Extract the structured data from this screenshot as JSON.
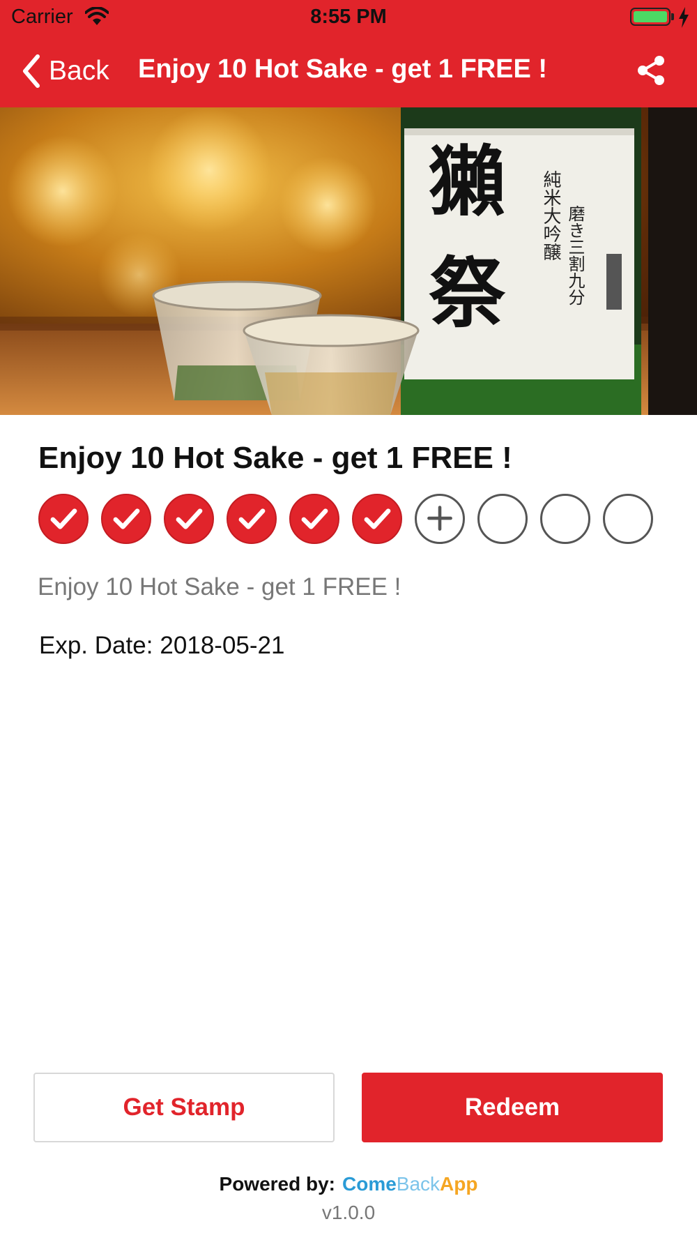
{
  "status_bar": {
    "carrier": "Carrier",
    "time": "8:55 PM",
    "battery_color": "#4cd964"
  },
  "nav": {
    "back_label": "Back",
    "title": "Enjoy 10 Hot Sake - get 1 FREE !",
    "share_icon": "share-icon",
    "background_color": "#e1242b"
  },
  "hero": {
    "image_name": "sake-bottle-with-glasses"
  },
  "card": {
    "title": "Enjoy 10 Hot Sake - get 1 FREE !",
    "description": "Enjoy 10 Hot Sake - get 1 FREE !",
    "exp_label": "Exp. Date:",
    "exp_date": "2018-05-21",
    "stamps_total": 10,
    "stamps_collected": 6,
    "stamp_states": [
      "done",
      "done",
      "done",
      "done",
      "done",
      "done",
      "next",
      "empty",
      "empty",
      "empty"
    ]
  },
  "actions": {
    "get_stamp_label": "Get Stamp",
    "redeem_label": "Redeem"
  },
  "footer": {
    "powered_by_label": "Powered by:",
    "brand_part1": "Come",
    "brand_part2": "Back",
    "brand_part3": "App",
    "version": "v1.0.0"
  },
  "colors": {
    "accent": "#e1242b",
    "brand_blue": "#2a9bd6",
    "brand_light_blue": "#7cc4ea",
    "brand_orange": "#f5a623"
  }
}
